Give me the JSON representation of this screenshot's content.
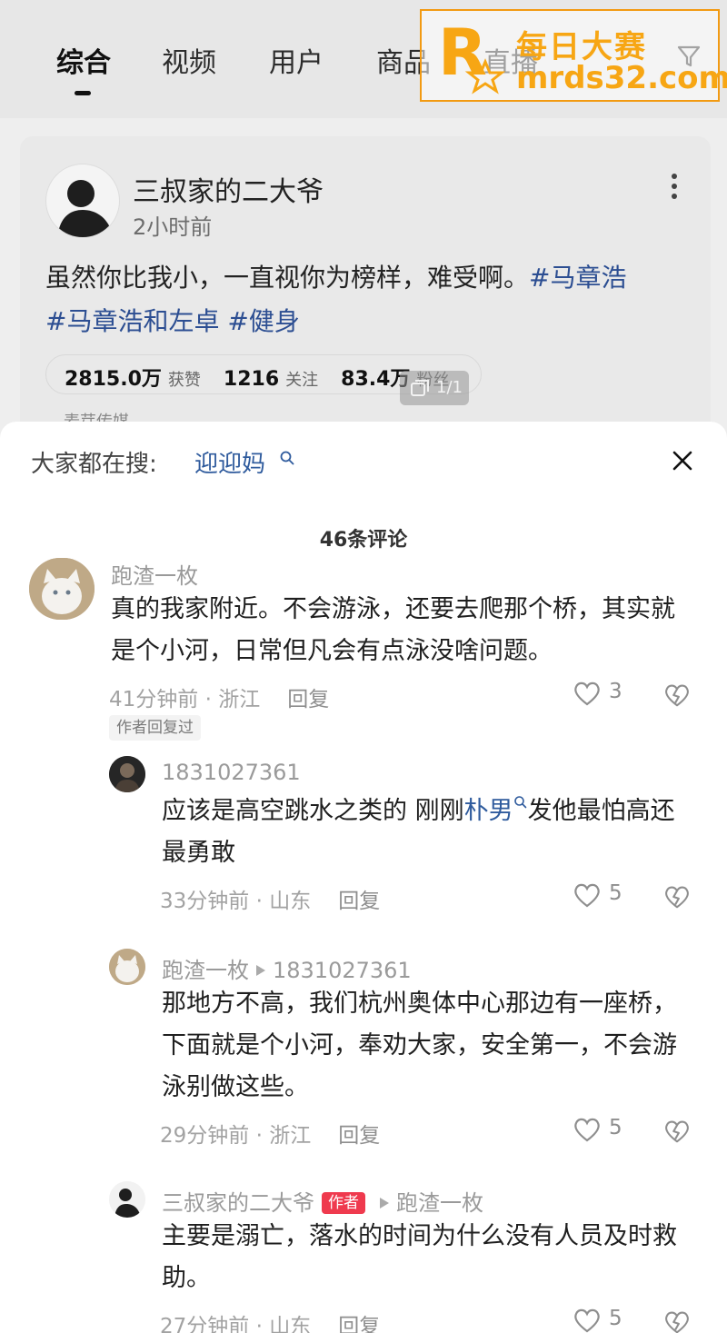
{
  "tabs": [
    {
      "label": "综合",
      "active": true
    },
    {
      "label": "视频"
    },
    {
      "label": "用户"
    },
    {
      "label": "商品"
    },
    {
      "label": "直播"
    }
  ],
  "watermark": {
    "name": "每日大赛",
    "url": "mrds32.com",
    "color": "#f7a614"
  },
  "post": {
    "author": "三叔家的二大爷",
    "time": "2小时前",
    "text": "虽然你比我小，一直视你为榜样，难受啊。",
    "tags": [
      "#马章浩",
      "#马章浩和左卓",
      "#健身"
    ],
    "stats": [
      {
        "value": "2815.0万",
        "label": "获赞"
      },
      {
        "value": "1216",
        "label": "关注"
      },
      {
        "value": "83.4万",
        "label": "粉丝"
      }
    ],
    "mcn": "麦芽传媒",
    "image_counter": "1/1"
  },
  "sheet": {
    "search_label": "大家都在搜:",
    "search_term": "迎迎妈",
    "comment_count": "46条评论",
    "author_replied_badge": "作者回复过",
    "author_badge": "作者",
    "reply_label": "回复"
  },
  "comments": [
    {
      "user": "跑渣一枚",
      "text": "真的我家附近。不会游泳，还要去爬那个桥，其实就是个小河，日常但凡会有点泳没啥问题。",
      "time": "41分钟前",
      "location": "浙江",
      "likes": "3"
    },
    {
      "user": "1831027361",
      "text_before": "应该是高空跳水之类的 刚刚",
      "keyword": "朴男",
      "text_after": "发他最怕高还最勇敢",
      "time": "33分钟前",
      "location": "山东",
      "likes": "5"
    },
    {
      "user": "跑渣一枚",
      "reply_to": "1831027361",
      "text": "那地方不高，我们杭州奥体中心那边有一座桥，下面就是个小河，奉劝大家，安全第一，不会游泳别做这些。",
      "time": "29分钟前",
      "location": "浙江",
      "likes": "5"
    },
    {
      "user": "三叔家的二大爷",
      "reply_to": "跑渣一枚",
      "text": "主要是溺亡，落水的时间为什么没有人员及时救助。",
      "time": "27分钟前",
      "location": "山东",
      "likes": "5"
    }
  ]
}
